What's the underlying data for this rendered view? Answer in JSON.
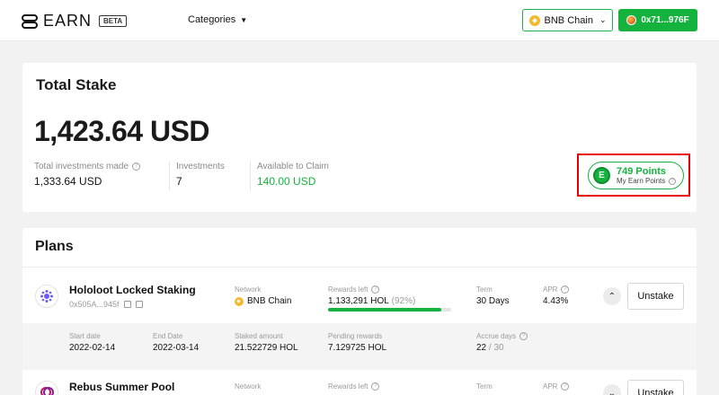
{
  "header": {
    "logo_text": "EARN",
    "beta_badge": "BETA",
    "categories_label": "Categories",
    "chain_label": "BNB Chain",
    "wallet_label": "0x71...976F"
  },
  "total_stake": {
    "title": "Total Stake",
    "total_value": "1,423.64 USD",
    "stats": [
      {
        "label": "Total investments made",
        "value": "1,333.64 USD"
      },
      {
        "label": "Investments",
        "value": "7"
      },
      {
        "label": "Available to Claim",
        "value": "140.00 USD"
      }
    ],
    "points": {
      "value": "749 Points",
      "label": "My Earn Points"
    }
  },
  "plans": {
    "title": "Plans",
    "items": [
      {
        "name": "Hololoot Locked Staking",
        "address": "0x505A...945f",
        "network_label": "Network",
        "network_value": "BNB Chain",
        "rewards_label": "Rewards left",
        "rewards_value": "1,133,291 HOL",
        "rewards_pct": "(92%)",
        "rewards_fraction": 0.92,
        "term_label": "Term",
        "term_value": "30 Days",
        "apr_label": "APR",
        "apr_value": "4.43%",
        "action_label": "Unstake",
        "details": {
          "start_label": "Start date",
          "start_value": "2022-02-14",
          "end_label": "End Date",
          "end_value": "2022-03-14",
          "staked_label": "Staked amount",
          "staked_value": "21.522729 HOL",
          "pending_label": "Pending rewards",
          "pending_value": "7.129725 HOL",
          "accrue_label": "Accrue days",
          "accrue_value": "22",
          "accrue_total": "/ 30"
        }
      },
      {
        "name": "Rebus Summer Pool",
        "network_label": "Network",
        "rewards_label": "Rewards left",
        "term_label": "Term",
        "apr_label": "APR",
        "action_label": "Unstake"
      }
    ]
  },
  "colors": {
    "accent": "#13b33e",
    "highlight_box": "#e60000",
    "bnb": "#f3ba2f"
  }
}
